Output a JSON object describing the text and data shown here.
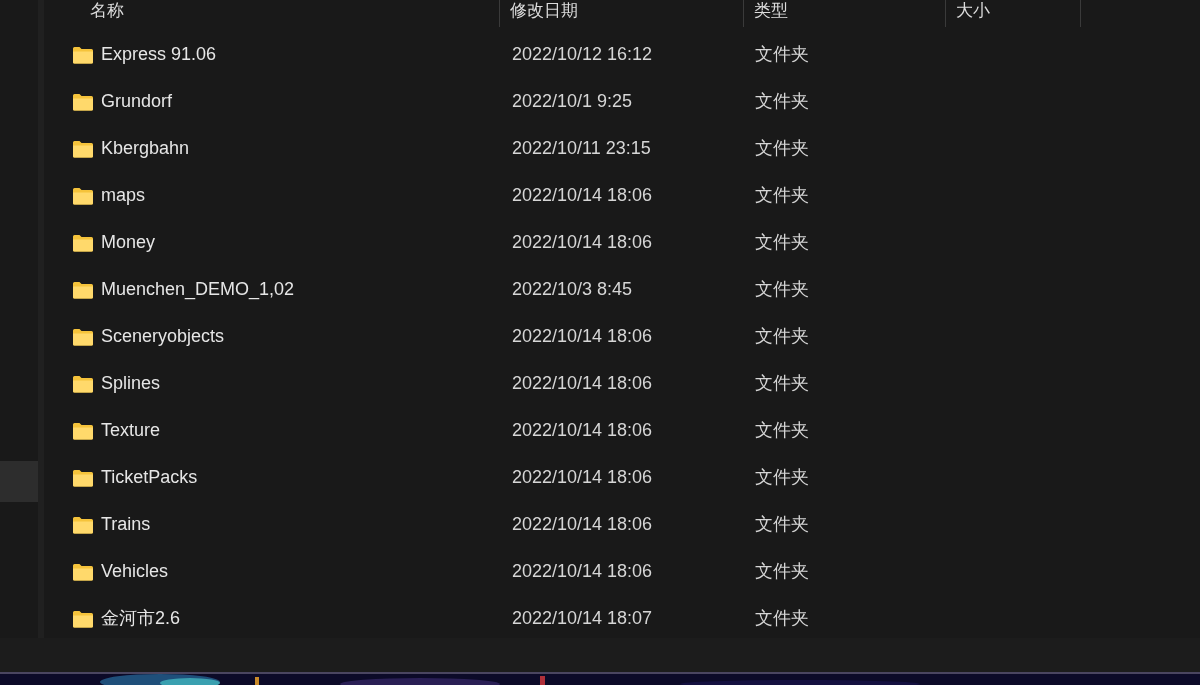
{
  "columns": [
    {
      "label": "名称"
    },
    {
      "label": "修改日期"
    },
    {
      "label": "类型"
    },
    {
      "label": "大小"
    }
  ],
  "rows": [
    {
      "name": "Express 91.06",
      "modified": "2022/10/12 16:12",
      "type": "文件夹"
    },
    {
      "name": "Grundorf",
      "modified": "2022/10/1 9:25",
      "type": "文件夹"
    },
    {
      "name": "Kbergbahn",
      "modified": "2022/10/11 23:15",
      "type": "文件夹"
    },
    {
      "name": "maps",
      "modified": "2022/10/14 18:06",
      "type": "文件夹"
    },
    {
      "name": "Money",
      "modified": "2022/10/14 18:06",
      "type": "文件夹"
    },
    {
      "name": "Muenchen_DEMO_1,02",
      "modified": "2022/10/3 8:45",
      "type": "文件夹"
    },
    {
      "name": "Sceneryobjects",
      "modified": "2022/10/14 18:06",
      "type": "文件夹"
    },
    {
      "name": "Splines",
      "modified": "2022/10/14 18:06",
      "type": "文件夹"
    },
    {
      "name": "Texture",
      "modified": "2022/10/14 18:06",
      "type": "文件夹"
    },
    {
      "name": "TicketPacks",
      "modified": "2022/10/14 18:06",
      "type": "文件夹"
    },
    {
      "name": "Trains",
      "modified": "2022/10/14 18:06",
      "type": "文件夹"
    },
    {
      "name": "Vehicles",
      "modified": "2022/10/14 18:06",
      "type": "文件夹"
    },
    {
      "name": "金河市2.6",
      "modified": "2022/10/14 18:07",
      "type": "文件夹"
    }
  ]
}
